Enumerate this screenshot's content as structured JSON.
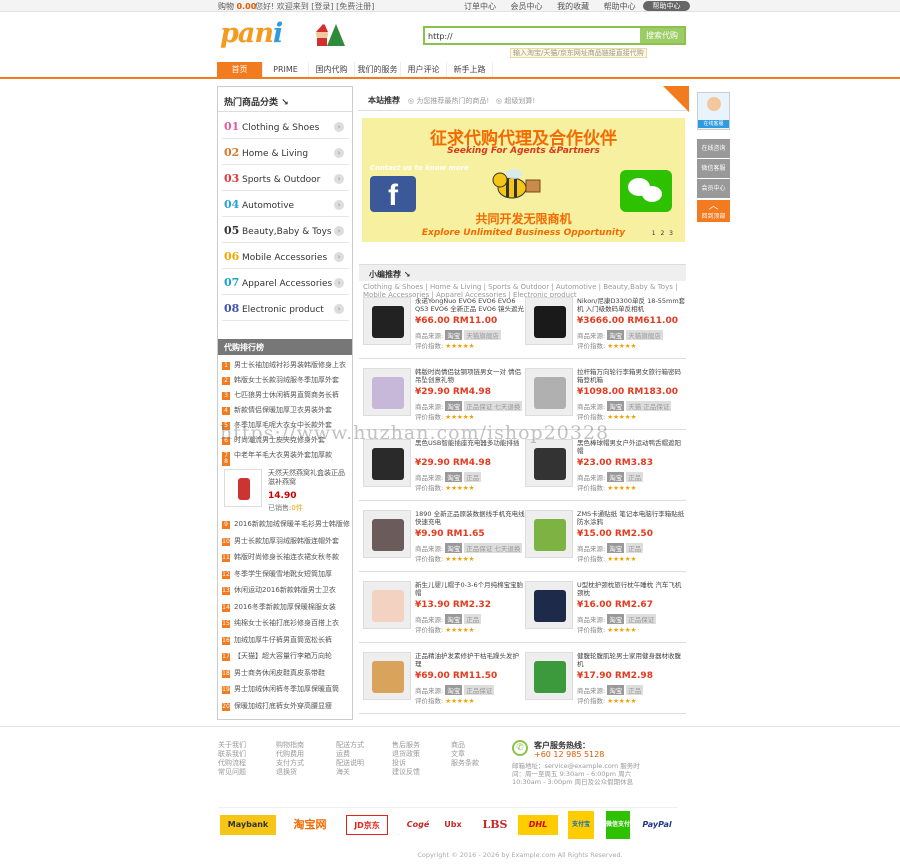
{
  "topbar": {
    "cart_label": "购物",
    "cart_amount": "0.00",
    "left_links": "您好! 欢迎来到 [登录] [免费注册]",
    "right_links": [
      "订单中心",
      "会员中心",
      "我的收藏",
      "帮助中心"
    ],
    "help_button": "帮助中心"
  },
  "logo": {
    "text_a": "pan",
    "text_b": "i"
  },
  "search": {
    "value": "http://",
    "button": "搜索代购",
    "tip": "输入淘宝/天猫/京东网址商品链接直接代购"
  },
  "nav": {
    "items": [
      "首页",
      "PRIME",
      "国内代购",
      "我们的服务",
      "用户评论",
      "新手上路"
    ]
  },
  "sidebar": {
    "title": "热门商品分类",
    "categories": [
      {
        "num": "01",
        "label": "Clothing & Shoes",
        "color": "#e85a9b"
      },
      {
        "num": "02",
        "label": "Home & Living",
        "color": "#d9772c"
      },
      {
        "num": "03",
        "label": "Sports & Outdoor",
        "color": "#e53935"
      },
      {
        "num": "04",
        "label": "Automotive",
        "color": "#2aa0d8"
      },
      {
        "num": "05",
        "label": "Beauty,Baby & Toys",
        "color": "#333333"
      },
      {
        "num": "06",
        "label": "Mobile Accessories",
        "color": "#f2a900"
      },
      {
        "num": "07",
        "label": "Apparel Accessories",
        "color": "#1aa3c9"
      },
      {
        "num": "08",
        "label": "Electronic product",
        "color": "#3f51b5"
      }
    ],
    "ranking_title": "代购排行榜",
    "ranking_top": [
      "男士长袖加绒衬衫男装韩版修身上衣",
      "韩版女士长款羽绒服冬季加厚外套",
      "七匹狼男士休闲裤男直筒商务长裤",
      "新款情侣保暖加厚卫衣男装外套",
      "冬季加厚毛呢大衣女中长款外套",
      "时尚潮流男士皮夹克修身外套",
      "中老年羊毛大衣男装外套加厚款"
    ],
    "ranking_feature": {
      "num": "8",
      "title": "天然天然燕窝礼盒装正品滋补燕窝",
      "price": "14.90",
      "sales_label": "已销售:",
      "sales_value": "0件"
    },
    "ranking_bottom": [
      {
        "num": "9",
        "text": "2016新款加绒保暖羊毛衫男士韩版修身"
      },
      {
        "num": "10",
        "text": "男士长款加厚羽绒服韩版连帽外套"
      },
      {
        "num": "11",
        "text": "韩版时尚修身长袖连衣裙女秋冬款"
      },
      {
        "num": "12",
        "text": "冬季学生保暖雪地靴女短筒加厚"
      },
      {
        "num": "13",
        "text": "休闲运动2016新款韩版男士卫衣"
      },
      {
        "num": "14",
        "text": "2016冬季新款加厚保暖棉服女装"
      },
      {
        "num": "15",
        "text": "纯棉女士长袖打底衫修身百搭上衣"
      },
      {
        "num": "16",
        "text": "加绒加厚牛仔裤男直筒宽松长裤"
      },
      {
        "num": "17",
        "text": "【天猫】超大容量行李箱万向轮"
      },
      {
        "num": "18",
        "text": "男士商务休闲皮鞋真皮系带鞋"
      },
      {
        "num": "19",
        "text": "男士加绒休闲裤冬季加厚保暖直筒"
      },
      {
        "num": "20",
        "text": "保暖加绒打底裤女外穿高腰显瘦"
      }
    ]
  },
  "main": {
    "tab_title": "本站推荐",
    "tab_hint_1": "为您推荐最热门的商品!",
    "tab_hint_2": "超级划算!",
    "banner": {
      "heading_cn": "征求代购代理及合作伙伴",
      "heading_en": "Seeking For Agents &Partners",
      "contact": "Contact us to know more",
      "fb_letter": "f",
      "bottom_cn": "共同开发无限商机",
      "bottom_en": "Explore Unlimited Business Opportunity",
      "page_dots": "1 2 3"
    },
    "small_title": "小编推荐",
    "cat_links": "Clothing & Shoes | Home & Living | Sports & Outdoor | Automotive | Beauty,Baby & Toys | Mobile Accessories | Apparel Accessories | Electronic product",
    "source_label": "商品来源:",
    "rating_label": "评价指数:",
    "stars": "★★★★★",
    "products": [
      {
        "title": "永诺YongNuo EVO6 EVO6 EVO6 QS3 EVO6 全新正品 EVO6 镜头遮光罩",
        "price": "¥66.00 RM11.00",
        "src": "淘宝",
        "tag": "天猫旗舰店"
      },
      {
        "title": "Nikon/尼康D3300单反 18-55mm套机 入门级数码单反相机",
        "price": "¥3666.00 RM611.00",
        "src": "淘宝",
        "tag": "天猫旗舰店"
      },
      {
        "title": "韩版时尚情侣钛钢项链男女一对 情侣吊坠创意礼物",
        "price": "¥29.90 RM4.98",
        "src": "淘宝",
        "tag": "正品保证 七天退换"
      },
      {
        "title": "拉杆箱万向轮行李箱男女旅行箱密码箱登机箱",
        "price": "¥1098.00 RM183.00",
        "src": "淘宝",
        "tag": "天猫 正品保证"
      },
      {
        "title": "黑色USB智能插座充电器多功能排插",
        "price": "¥29.90 RM4.98",
        "src": "淘宝",
        "tag": "正品"
      },
      {
        "title": "黑色棒球帽男女户外运动鸭舌帽遮阳帽",
        "price": "¥23.00 RM3.83",
        "src": "淘宝",
        "tag": "正品"
      },
      {
        "title": "1890 全新正品原装数据线手机充电线 快速充电",
        "price": "¥9.90 RM1.65",
        "src": "淘宝",
        "tag": "正品保证 七天退换"
      },
      {
        "title": "ZMS卡通贴纸 笔记本电脑行李箱贴纸 防水涂鸦",
        "price": "¥15.00 RM2.50",
        "src": "淘宝",
        "tag": "正品"
      },
      {
        "title": "新生儿婴儿帽子0-3-6个月纯棉宝宝胎帽",
        "price": "¥13.90 RM2.32",
        "src": "淘宝",
        "tag": "正品"
      },
      {
        "title": "U型枕护颈枕旅行枕午睡枕 汽车飞机颈枕",
        "price": "¥16.00 RM2.67",
        "src": "淘宝",
        "tag": "正品保证"
      },
      {
        "title": "正品精油护发素修护干枯毛躁头发护理",
        "price": "¥69.00 RM11.50",
        "src": "淘宝",
        "tag": "正品保证"
      },
      {
        "title": "健腹轮腹肌轮男士家用健身器材收腹机",
        "price": "¥17.90 RM2.98",
        "src": "淘宝",
        "tag": "正品"
      }
    ]
  },
  "watermark": "https://www.huzhan.com/ishop20328",
  "floatbar": {
    "avatar_label": "在线客服",
    "buttons": [
      "在线咨询",
      "微信客服",
      "会员中心"
    ],
    "top_label": "回到顶部"
  },
  "footer": {
    "cols": [
      [
        "关于我们",
        "联系我们",
        "代购流程",
        "常见问题"
      ],
      [
        "购物指南",
        "代购费用",
        "支付方式",
        "退换货"
      ],
      [
        "配送方式",
        "运费",
        "配送说明",
        "海关"
      ],
      [
        "售后服务",
        "退货政策",
        "投诉",
        "建议反馈"
      ],
      [
        "商品",
        "文章",
        "服务条款"
      ]
    ],
    "service_title": "客户服务热线：",
    "service_number": "+60 12 985 5128",
    "service_info": "邮箱地址：service@example.com 服务时间：周一至周五 9:30am - 6:00pm 周六 10:30am - 3:00pm 周日及公众假期休息",
    "payments": [
      "Maybank",
      "淘宝网",
      "JD京东",
      "Cogé",
      "Ubx",
      "LBS",
      "DHL",
      "支付宝",
      "微信支付",
      "PayPal"
    ],
    "copyright": "Copyright © 2016 - 2026 by Example.com All Rights Reserved."
  },
  "colors": {
    "accent": "#f37b1f",
    "price": "#e53a1f",
    "search": "#8bc34a"
  }
}
